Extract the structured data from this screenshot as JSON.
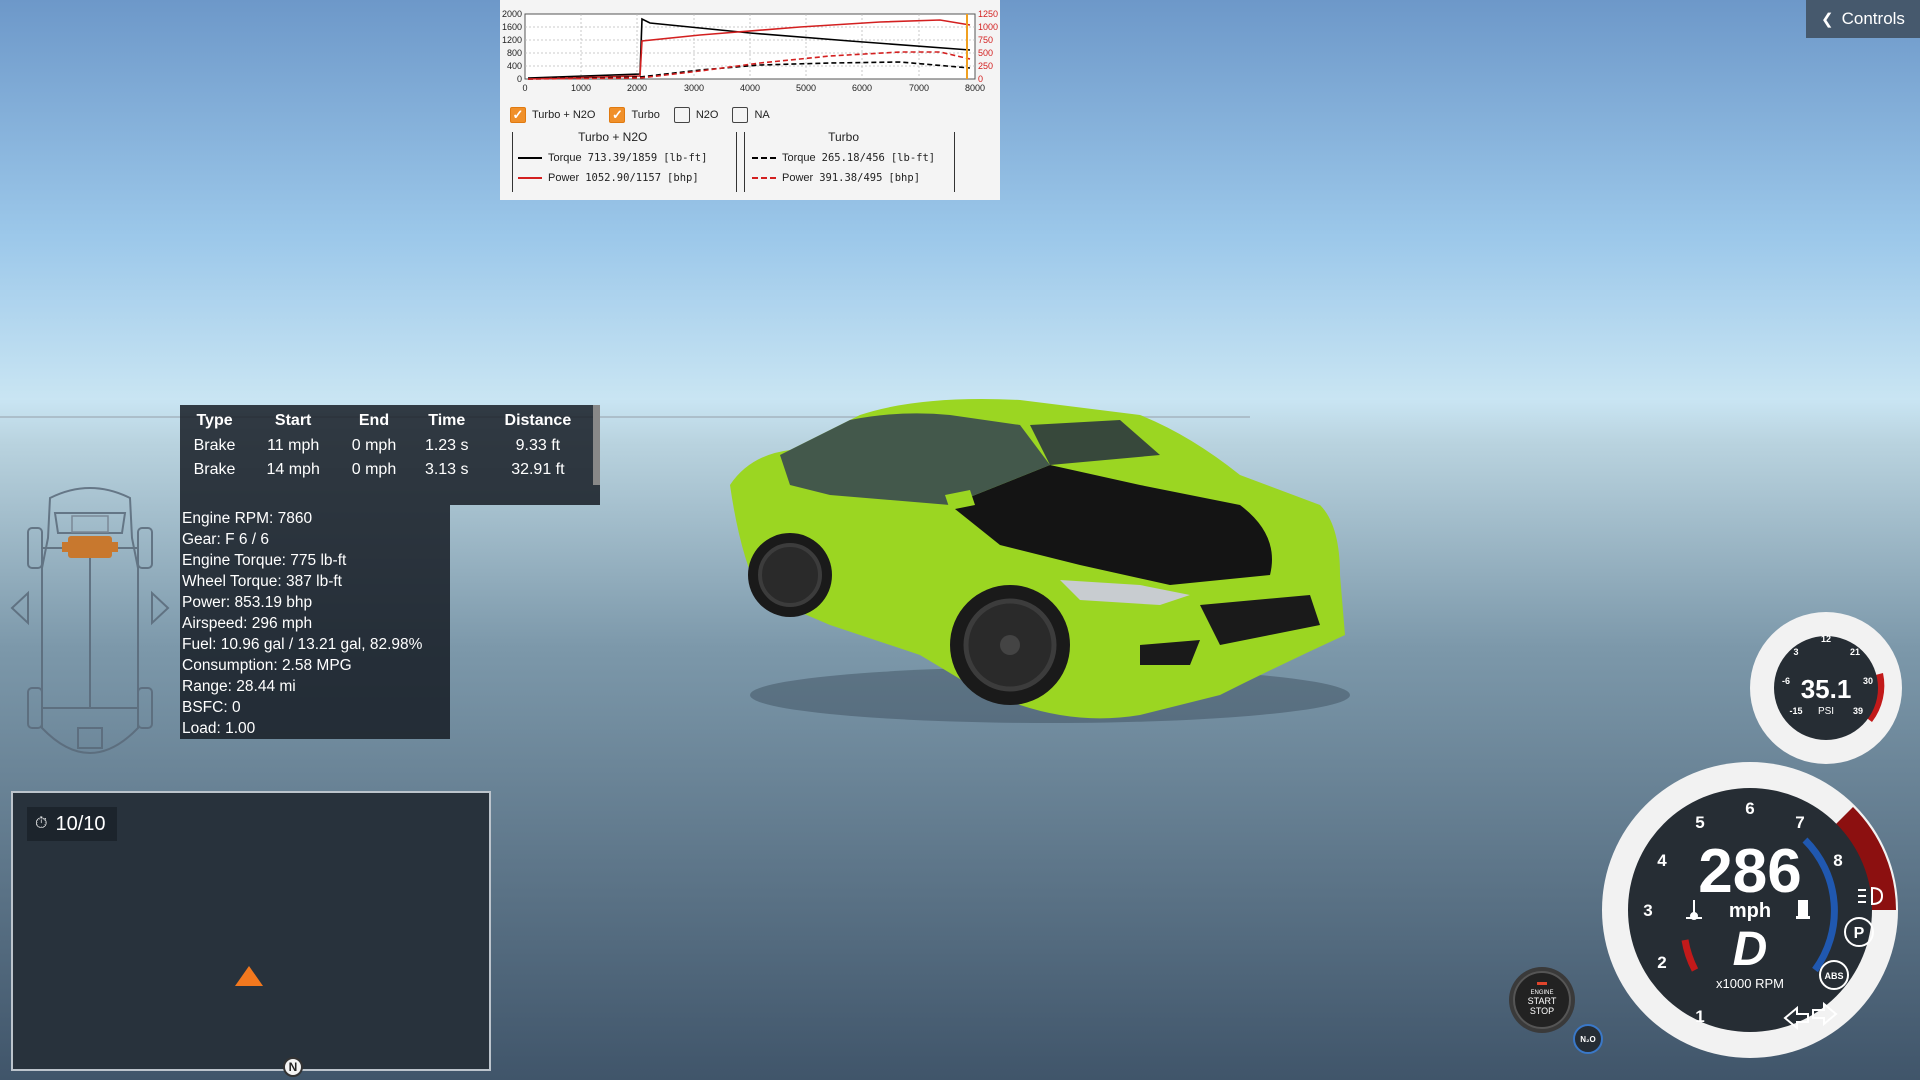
{
  "graph": {
    "y_left_ticks": [
      "2000",
      "1600",
      "1200",
      "800",
      "400",
      "0"
    ],
    "y_right_ticks": [
      "1250",
      "1000",
      "750",
      "500",
      "250",
      "0"
    ],
    "x_ticks": [
      "0",
      "1000",
      "2000",
      "3000",
      "4000",
      "5000",
      "6000",
      "7000",
      "8000"
    ],
    "colors": {
      "torque": "#000000",
      "power": "#d32020",
      "marker": "#f0a020"
    }
  },
  "filters": [
    {
      "label": "Turbo + N2O",
      "checked": true
    },
    {
      "label": "Turbo",
      "checked": true
    },
    {
      "label": "N2O",
      "checked": false
    },
    {
      "label": "NA",
      "checked": false
    }
  ],
  "legend": {
    "left": {
      "title": "Turbo + N2O",
      "torque_label": "Torque",
      "torque_value": "713.39/1859",
      "torque_unit": "[lb-ft]",
      "power_label": "Power",
      "power_value": "1052.90/1157",
      "power_unit": "[bhp]"
    },
    "right": {
      "title": "Turbo",
      "torque_label": "Torque",
      "torque_value": "265.18/456",
      "torque_unit": "[lb-ft]",
      "power_label": "Power",
      "power_value": "391.38/495",
      "power_unit": "[bhp]"
    }
  },
  "controls": {
    "label": "Controls"
  },
  "brake_table": {
    "headers": [
      "Type",
      "Start",
      "End",
      "Time",
      "Distance"
    ],
    "rows": [
      [
        "Brake",
        "11 mph",
        "0 mph",
        "1.23 s",
        "9.33 ft"
      ],
      [
        "Brake",
        "14 mph",
        "0 mph",
        "3.13 s",
        "32.91 ft"
      ]
    ]
  },
  "stats": [
    "Engine RPM: 7860",
    "Gear: F 6 / 6",
    "Engine Torque: 775 lb-ft",
    "Wheel Torque: 387 lb-ft",
    "Power: 853.19 bhp",
    "Airspeed: 296 mph",
    "Fuel: 10.96 gal / 13.21 gal, 82.98%",
    "Consumption: 2.58 MPG",
    "Range: 28.44 mi",
    "BSFC: 0",
    "Load: 1.00"
  ],
  "minimap": {
    "counter": "10/10",
    "north": "N"
  },
  "boost": {
    "value": "35.1",
    "unit": "PSI",
    "ticks": [
      "3",
      "12",
      "21",
      "-6",
      "30",
      "-15",
      "39"
    ]
  },
  "speedo": {
    "speed": "286",
    "unit": "mph",
    "gear": "D",
    "rpm_label": "x1000 RPM",
    "rpm_ticks": [
      "1",
      "2",
      "3",
      "4",
      "5",
      "6",
      "7",
      "8"
    ],
    "abs": "ABS",
    "park": "P"
  },
  "engine_button": {
    "line1": "ENGINE",
    "line2": "START",
    "line3": "STOP"
  },
  "n2o_button": {
    "label": "N₂O"
  }
}
